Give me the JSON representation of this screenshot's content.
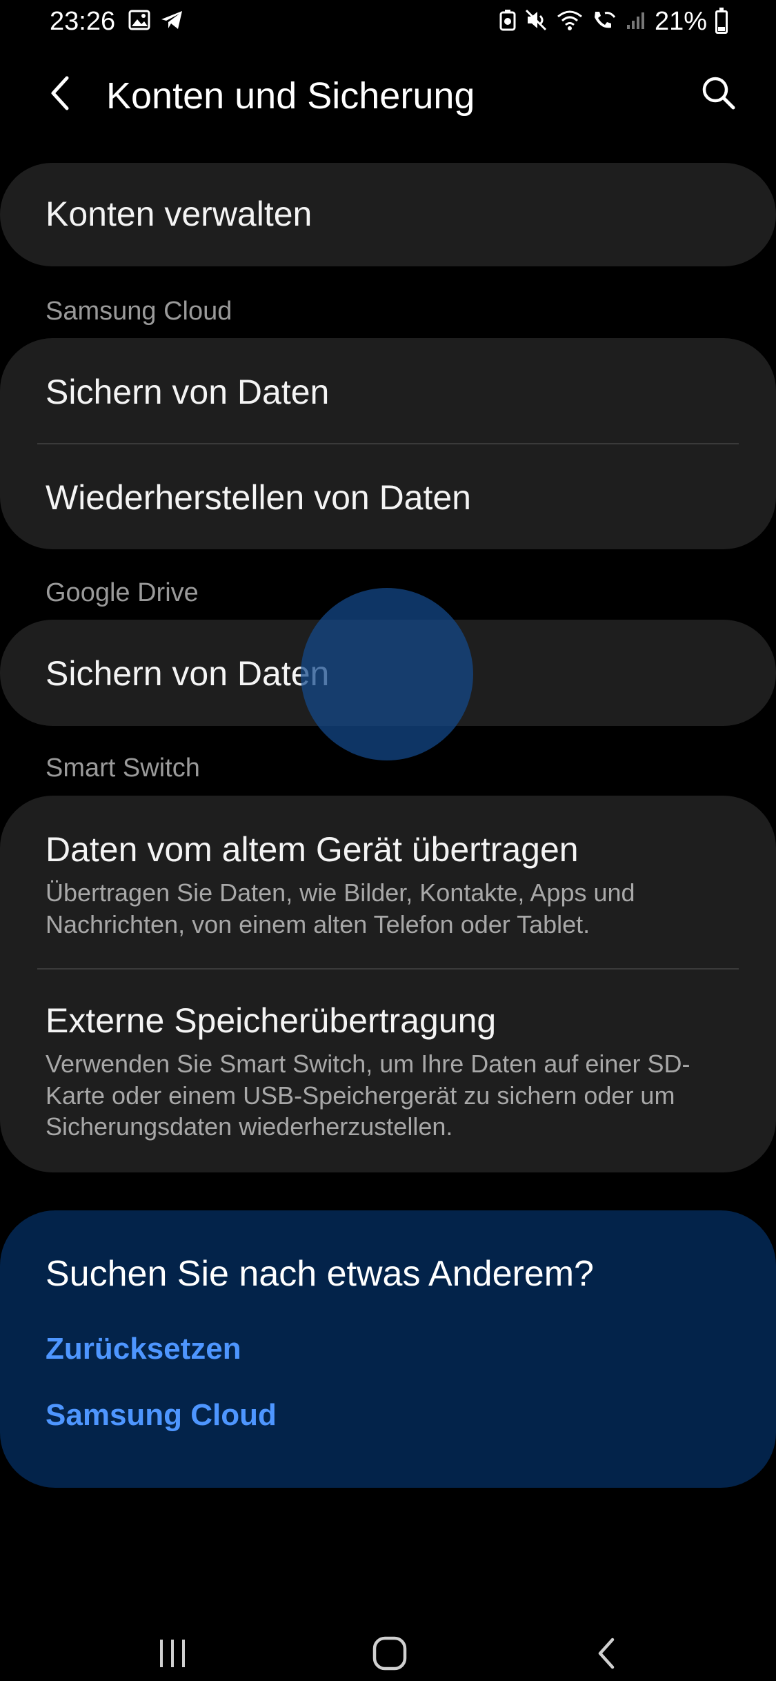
{
  "status_bar": {
    "time": "23:26",
    "battery_text": "21%",
    "left_icons": [
      "image-icon",
      "telegram-icon"
    ],
    "right_icons": [
      "recycle-icon",
      "mute-icon",
      "wifi-icon",
      "wifi-call-icon",
      "signal-icon",
      "battery-icon"
    ],
    "battery_level": 0.21
  },
  "app_bar": {
    "title": "Konten und Sicherung",
    "back_icon": "chevron-left-icon",
    "search_icon": "search-icon"
  },
  "sections": {
    "accounts": {
      "manage_label": "Konten verwalten"
    },
    "samsung_cloud": {
      "header": "Samsung Cloud",
      "backup_label": "Sichern von Daten",
      "restore_label": "Wiederherstellen von Daten"
    },
    "google_drive": {
      "header": "Google Drive",
      "backup_label": "Sichern von Daten"
    },
    "smart_switch": {
      "header": "Smart Switch",
      "transfer_title": "Daten vom altem Gerät übertragen",
      "transfer_desc": "Übertragen Sie Daten, wie Bilder, Kontakte, Apps und Nachrichten, von einem alten Telefon oder Tablet.",
      "external_title": "Externe Speicherübertragung",
      "external_desc": "Verwenden Sie Smart Switch, um Ihre Daten auf einer SD-Karte oder einem USB-Speichergerät zu sichern oder um Sicherungsdaten wiederherzustellen."
    }
  },
  "suggestions": {
    "title": "Suchen Sie nach etwas Anderem?",
    "links": [
      "Zurücksetzen",
      "Samsung Cloud"
    ]
  },
  "nav_bar": {
    "icons": [
      "recent-apps-icon",
      "home-icon",
      "back-icon"
    ]
  },
  "colors": {
    "background": "#000000",
    "card": "#1e1e1e",
    "suggestion_card": "#03234a",
    "link": "#4e96ff",
    "section_header": "#9a9a9a",
    "ripple": "#144a8c"
  }
}
